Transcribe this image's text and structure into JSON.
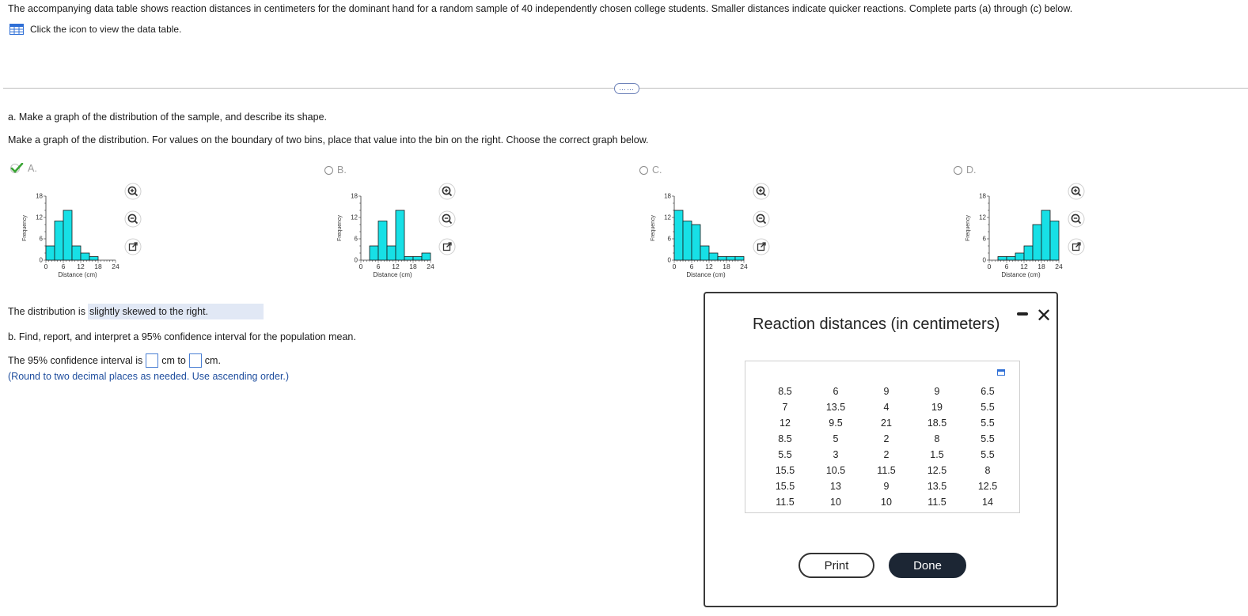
{
  "intro_text": "The accompanying data table shows reaction distances in centimeters for the dominant hand for a random sample of 40 independently chosen college students. Smaller distances indicate quicker reactions. Complete parts (a) through (c) below.",
  "click_icon_text": "Click the icon to view the data table.",
  "more_button_label": "……",
  "part_a": {
    "question": "a. Make a graph of the distribution of the sample, and describe its shape.",
    "instruction": "Make a graph of the distribution. For values on the boundary of two bins, place that value into the bin on the right. Choose the correct graph below.",
    "options": [
      {
        "label": "A.",
        "selected": true
      },
      {
        "label": "B.",
        "selected": false
      },
      {
        "label": "C.",
        "selected": false
      },
      {
        "label": "D.",
        "selected": false
      }
    ],
    "answer_prefix": "The distribution is",
    "answer_value": "slightly skewed to the right."
  },
  "hist_common": {
    "ylabel": "Frequency",
    "xlabel": "Distance (cm)",
    "yticks": [
      "18",
      "12",
      "6",
      "0"
    ],
    "xticks": [
      "0",
      "6",
      "12",
      "18",
      "24"
    ],
    "bar_color": "#17e0e6",
    "bin_width": 3
  },
  "chart_data": [
    {
      "type": "bar",
      "option": "A",
      "bin_width": 3,
      "bin_start": 0,
      "values": [
        4,
        11,
        14,
        4,
        2,
        1,
        0,
        0
      ],
      "ylim": [
        0,
        18
      ],
      "xlim": [
        0,
        24
      ],
      "xlabel": "Distance (cm)",
      "ylabel": "Frequency"
    },
    {
      "type": "bar",
      "option": "B",
      "bin_width": 3,
      "bin_start": 0,
      "values": [
        0,
        4,
        11,
        4,
        14,
        1,
        1,
        2
      ],
      "ylim": [
        0,
        18
      ],
      "xlim": [
        0,
        24
      ],
      "xlabel": "Distance (cm)",
      "ylabel": "Frequency"
    },
    {
      "type": "bar",
      "option": "C",
      "bin_width": 3,
      "bin_start": 0,
      "values": [
        14,
        11,
        10,
        4,
        2,
        1,
        1,
        1
      ],
      "ylim": [
        0,
        18
      ],
      "xlim": [
        0,
        24
      ],
      "xlabel": "Distance (cm)",
      "ylabel": "Frequency"
    },
    {
      "type": "bar",
      "option": "D",
      "bin_width": 3,
      "bin_start": 0,
      "values": [
        0,
        1,
        1,
        2,
        4,
        10,
        14,
        11
      ],
      "ylim": [
        0,
        18
      ],
      "xlim": [
        0,
        24
      ],
      "xlabel": "Distance (cm)",
      "ylabel": "Frequency"
    }
  ],
  "part_b": {
    "question": "b. Find, report, and interpret a 95% confidence interval for the population mean.",
    "ci_prefix": "The 95% confidence interval is",
    "ci_mid": "cm to",
    "ci_suffix": "cm.",
    "round_note": "(Round to two decimal places as needed. Use ascending order.)"
  },
  "dialog": {
    "title": "Reaction distances (in centimeters)",
    "print_label": "Print",
    "done_label": "Done",
    "rows": [
      [
        "8.5",
        "6",
        "9",
        "9",
        "6.5"
      ],
      [
        "7",
        "13.5",
        "4",
        "19",
        "5.5"
      ],
      [
        "12",
        "9.5",
        "21",
        "18.5",
        "5.5"
      ],
      [
        "8.5",
        "5",
        "2",
        "8",
        "5.5"
      ],
      [
        "5.5",
        "3",
        "2",
        "1.5",
        "5.5"
      ],
      [
        "15.5",
        "10.5",
        "11.5",
        "12.5",
        "8"
      ],
      [
        "15.5",
        "13",
        "9",
        "13.5",
        "12.5"
      ],
      [
        "11.5",
        "10",
        "10",
        "11.5",
        "14"
      ]
    ]
  },
  "colors": {
    "accent": "#1f4e9e",
    "check": "#3aa535",
    "dialog_done_bg": "#1c2634",
    "answer_bg": "#e1e8f5"
  }
}
